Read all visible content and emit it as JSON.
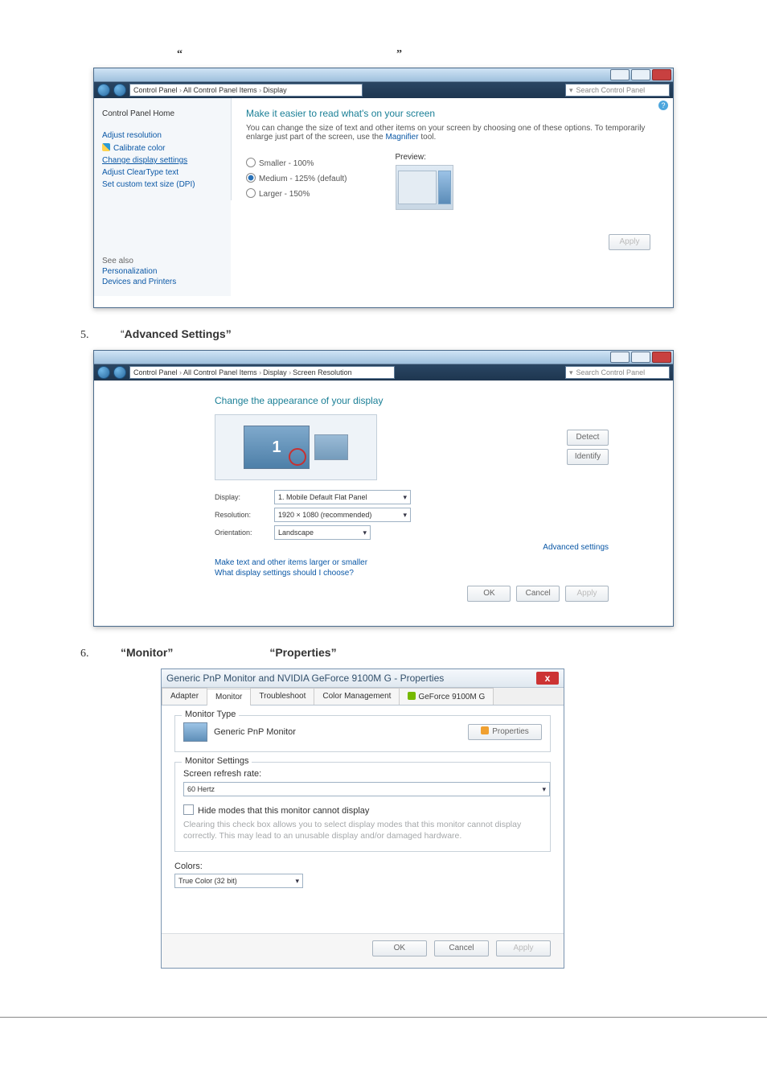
{
  "quotes": {
    "open": "“",
    "close": "”"
  },
  "win1": {
    "breadcrumb": [
      "Control Panel",
      "All Control Panel Items",
      "Display"
    ],
    "search_placeholder": "Search Control Panel",
    "sidebar": {
      "home": "Control Panel Home",
      "items": [
        "Adjust resolution",
        "Calibrate color",
        "Change display settings",
        "Adjust ClearType text",
        "Set custom text size (DPI)"
      ]
    },
    "title": "Make it easier to read what's on your screen",
    "desc_a": "You can change the size of text and other items on your screen by choosing one of these options. To temporarily enlarge just part of the screen, use the ",
    "desc_link": "Magnifier",
    "desc_b": " tool.",
    "radios": [
      "Smaller - 100%",
      "Medium - 125% (default)",
      "Larger - 150%"
    ],
    "preview_label": "Preview:",
    "apply": "Apply",
    "seealso": {
      "header": "See also",
      "items": [
        "Personalization",
        "Devices and Printers"
      ]
    }
  },
  "step5": {
    "num": "5.",
    "prefix": "“",
    "bold": "Advanced Settings”"
  },
  "win2": {
    "breadcrumb": [
      "Control Panel",
      "All Control Panel Items",
      "Display",
      "Screen Resolution"
    ],
    "search_placeholder": "Search Control Panel",
    "title": "Change the appearance of your display",
    "mon1": "1",
    "detect": "Detect",
    "identify": "Identify",
    "form": {
      "display_label": "Display:",
      "display_value": "1. Mobile Default Flat Panel",
      "resolution_label": "Resolution:",
      "resolution_value": "1920 × 1080 (recommended)",
      "orientation_label": "Orientation:",
      "orientation_value": "Landscape"
    },
    "advanced": "Advanced settings",
    "link1": "Make text and other items larger or smaller",
    "link2": "What display settings should I choose?",
    "ok": "OK",
    "cancel": "Cancel",
    "apply": "Apply"
  },
  "step6": {
    "num": "6.",
    "a": "“Monitor”",
    "b": "“Properties”"
  },
  "dlg": {
    "title": "Generic PnP Monitor and NVIDIA GeForce 9100M G - Properties",
    "tabs": [
      "Adapter",
      "Monitor",
      "Troubleshoot",
      "Color Management",
      "GeForce 9100M G"
    ],
    "monitor_type_legend": "Monitor Type",
    "monitor_name": "Generic PnP Monitor",
    "properties_btn": "Properties",
    "monitor_settings_legend": "Monitor Settings",
    "refresh_label": "Screen refresh rate:",
    "refresh_value": "60 Hertz",
    "hide_modes": "Hide modes that this monitor cannot display",
    "hide_hint": "Clearing this check box allows you to select display modes that this monitor cannot display correctly. This may lead to an unusable display and/or damaged hardware.",
    "colors_label": "Colors:",
    "colors_value": "True Color (32 bit)",
    "ok": "OK",
    "cancel": "Cancel",
    "apply": "Apply"
  }
}
